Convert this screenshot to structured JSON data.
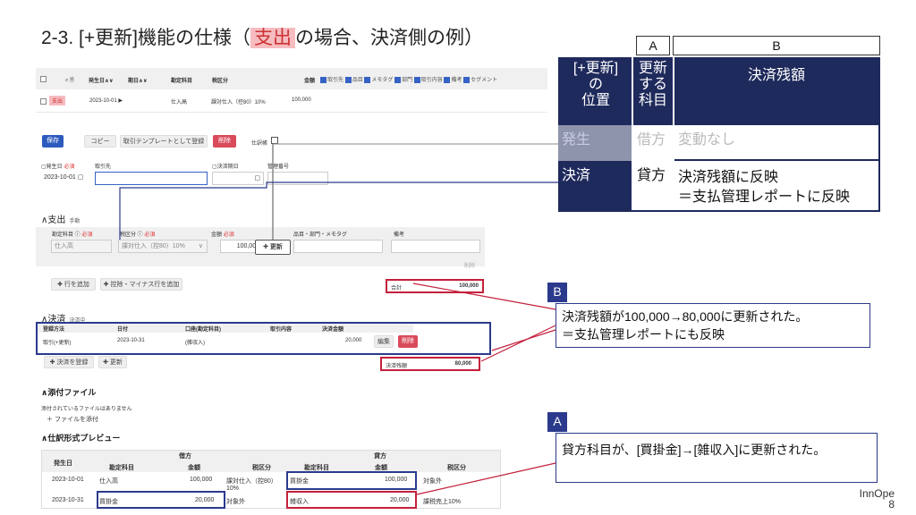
{
  "slide": {
    "title_pre": "2-3. [+更新]機能の仕様（",
    "title_hl": "支出",
    "title_post": "の場合、決済側の例）",
    "brand": "InnOpe",
    "page": "8"
  },
  "list": {
    "headers": [
      "発生日∧∨",
      "期日∧∨",
      "勘定科目",
      "税区分",
      "金額"
    ],
    "toggles": [
      "取引先",
      "品目",
      "メモタグ",
      "部門",
      "取引内容",
      "備考",
      "セグメント"
    ],
    "row": {
      "type": "支出",
      "date": "2023-10-01 ▶",
      "account": "仕入高",
      "tax": "課対仕入（控80）10%",
      "amount": "100,000"
    }
  },
  "form": {
    "save": "保存",
    "copy": "コピー",
    "template": "取引テンプレートとして登録",
    "delete": "削除",
    "journal": "仕訳帳",
    "date_label": "発生日",
    "required": "必須",
    "partner_label": "取引先",
    "due_label": "決済期日",
    "mgmt_label": "管理番号",
    "date_value": "2023-10-01"
  },
  "expense": {
    "title": "支出",
    "mode": "手動",
    "col_account": "勘定科目",
    "col_tax": "税区分",
    "col_amount": "金額",
    "col_item": "品目・部門・メモタグ",
    "col_note": "備考",
    "account": "仕入高",
    "tax": "課対仕入（控80）10%",
    "amount": "100,000",
    "update_btn": "✚ 更新",
    "delete_link": "削除",
    "add_row": "✚ 行を追加",
    "add_minus": "✚ 控除・マイナス行を追加",
    "total_label": "合計",
    "total_value": "100,000"
  },
  "settle": {
    "title": "決済",
    "status": "決済中",
    "headers": [
      "登録方法",
      "日付",
      "口座(勘定科目)",
      "取引内容",
      "決済金額"
    ],
    "row": {
      "method": "取引(+更新)",
      "date": "2023-10-31",
      "account": "(雑収入)",
      "amount": "20,000"
    },
    "edit": "編集",
    "delete": "削除",
    "register": "✚ 決済を登録",
    "update": "✚ 更新",
    "balance_label": "決済残額",
    "balance_value": "80,000"
  },
  "attach": {
    "title": "添付ファイル",
    "empty": "添付されているファイルはありません",
    "add": "＋ ファイルを添付"
  },
  "preview": {
    "title": "仕訳形式プレビュー",
    "debit": "借方",
    "credit": "貸方",
    "date_col": "発生日",
    "sub_headers": [
      "勘定科目",
      "金額",
      "税区分",
      "勘定科目",
      "金額",
      "税区分"
    ],
    "rows": [
      {
        "date": "2023-10-01",
        "d_acct": "仕入高",
        "d_amt": "100,000",
        "d_tax": "課対仕入（控80）10%",
        "c_acct": "買掛金",
        "c_amt": "100,000",
        "c_tax": "対象外"
      },
      {
        "date": "2023-10-31",
        "d_acct": "買掛金",
        "d_amt": "20,000",
        "d_tax": "対象外",
        "c_acct": "雑収入",
        "c_amt": "20,000",
        "c_tax": "課税売上10%"
      }
    ]
  },
  "spec_table": {
    "label_a": "A",
    "label_b": "B",
    "h1": "[+更新]\nの\n位置",
    "h2": "更新\nする\n科目",
    "h3": "決済残額",
    "rows": [
      {
        "pos": "発生",
        "subj": "借方",
        "effect": "変動なし"
      },
      {
        "pos": "決済",
        "subj": "貸方",
        "effect": "決済残額に反映\n＝支払管理レポートに反映"
      }
    ]
  },
  "callout_b": {
    "tag": "B",
    "text": "決済残額が100,000→80,000に更新された。\n＝支払管理レポートにも反映"
  },
  "callout_a": {
    "tag": "A",
    "text": "貸方科目が、[買掛金]→[雑収入]に更新された。"
  },
  "colors": {
    "navy": "#1f2a5c",
    "red": "#c4203c",
    "blue": "#2d5bbd"
  }
}
